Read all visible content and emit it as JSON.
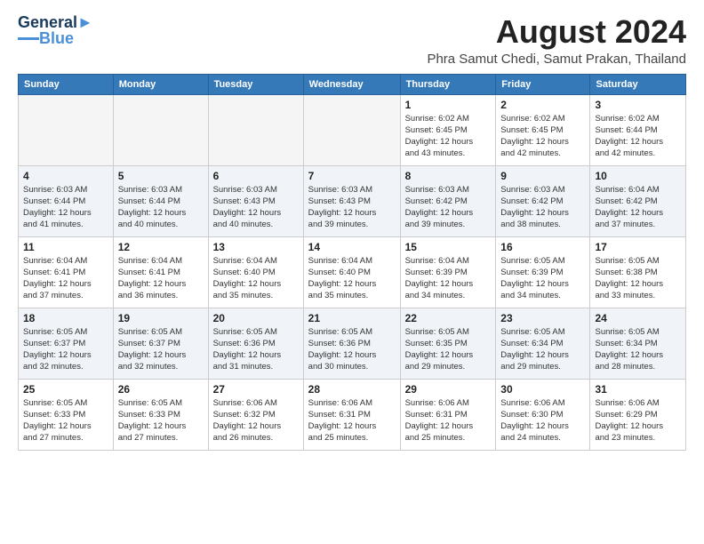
{
  "header": {
    "logo": {
      "line1": "General",
      "line2": "Blue"
    },
    "title": "August 2024",
    "location": "Phra Samut Chedi, Samut Prakan, Thailand"
  },
  "weekdays": [
    "Sunday",
    "Monday",
    "Tuesday",
    "Wednesday",
    "Thursday",
    "Friday",
    "Saturday"
  ],
  "weeks": [
    [
      {
        "date": "",
        "info": ""
      },
      {
        "date": "",
        "info": ""
      },
      {
        "date": "",
        "info": ""
      },
      {
        "date": "",
        "info": ""
      },
      {
        "date": "1",
        "info": "Sunrise: 6:02 AM\nSunset: 6:45 PM\nDaylight: 12 hours\nand 43 minutes."
      },
      {
        "date": "2",
        "info": "Sunrise: 6:02 AM\nSunset: 6:45 PM\nDaylight: 12 hours\nand 42 minutes."
      },
      {
        "date": "3",
        "info": "Sunrise: 6:02 AM\nSunset: 6:44 PM\nDaylight: 12 hours\nand 42 minutes."
      }
    ],
    [
      {
        "date": "4",
        "info": "Sunrise: 6:03 AM\nSunset: 6:44 PM\nDaylight: 12 hours\nand 41 minutes."
      },
      {
        "date": "5",
        "info": "Sunrise: 6:03 AM\nSunset: 6:44 PM\nDaylight: 12 hours\nand 40 minutes."
      },
      {
        "date": "6",
        "info": "Sunrise: 6:03 AM\nSunset: 6:43 PM\nDaylight: 12 hours\nand 40 minutes."
      },
      {
        "date": "7",
        "info": "Sunrise: 6:03 AM\nSunset: 6:43 PM\nDaylight: 12 hours\nand 39 minutes."
      },
      {
        "date": "8",
        "info": "Sunrise: 6:03 AM\nSunset: 6:42 PM\nDaylight: 12 hours\nand 39 minutes."
      },
      {
        "date": "9",
        "info": "Sunrise: 6:03 AM\nSunset: 6:42 PM\nDaylight: 12 hours\nand 38 minutes."
      },
      {
        "date": "10",
        "info": "Sunrise: 6:04 AM\nSunset: 6:42 PM\nDaylight: 12 hours\nand 37 minutes."
      }
    ],
    [
      {
        "date": "11",
        "info": "Sunrise: 6:04 AM\nSunset: 6:41 PM\nDaylight: 12 hours\nand 37 minutes."
      },
      {
        "date": "12",
        "info": "Sunrise: 6:04 AM\nSunset: 6:41 PM\nDaylight: 12 hours\nand 36 minutes."
      },
      {
        "date": "13",
        "info": "Sunrise: 6:04 AM\nSunset: 6:40 PM\nDaylight: 12 hours\nand 35 minutes."
      },
      {
        "date": "14",
        "info": "Sunrise: 6:04 AM\nSunset: 6:40 PM\nDaylight: 12 hours\nand 35 minutes."
      },
      {
        "date": "15",
        "info": "Sunrise: 6:04 AM\nSunset: 6:39 PM\nDaylight: 12 hours\nand 34 minutes."
      },
      {
        "date": "16",
        "info": "Sunrise: 6:05 AM\nSunset: 6:39 PM\nDaylight: 12 hours\nand 34 minutes."
      },
      {
        "date": "17",
        "info": "Sunrise: 6:05 AM\nSunset: 6:38 PM\nDaylight: 12 hours\nand 33 minutes."
      }
    ],
    [
      {
        "date": "18",
        "info": "Sunrise: 6:05 AM\nSunset: 6:37 PM\nDaylight: 12 hours\nand 32 minutes."
      },
      {
        "date": "19",
        "info": "Sunrise: 6:05 AM\nSunset: 6:37 PM\nDaylight: 12 hours\nand 32 minutes."
      },
      {
        "date": "20",
        "info": "Sunrise: 6:05 AM\nSunset: 6:36 PM\nDaylight: 12 hours\nand 31 minutes."
      },
      {
        "date": "21",
        "info": "Sunrise: 6:05 AM\nSunset: 6:36 PM\nDaylight: 12 hours\nand 30 minutes."
      },
      {
        "date": "22",
        "info": "Sunrise: 6:05 AM\nSunset: 6:35 PM\nDaylight: 12 hours\nand 29 minutes."
      },
      {
        "date": "23",
        "info": "Sunrise: 6:05 AM\nSunset: 6:34 PM\nDaylight: 12 hours\nand 29 minutes."
      },
      {
        "date": "24",
        "info": "Sunrise: 6:05 AM\nSunset: 6:34 PM\nDaylight: 12 hours\nand 28 minutes."
      }
    ],
    [
      {
        "date": "25",
        "info": "Sunrise: 6:05 AM\nSunset: 6:33 PM\nDaylight: 12 hours\nand 27 minutes."
      },
      {
        "date": "26",
        "info": "Sunrise: 6:05 AM\nSunset: 6:33 PM\nDaylight: 12 hours\nand 27 minutes."
      },
      {
        "date": "27",
        "info": "Sunrise: 6:06 AM\nSunset: 6:32 PM\nDaylight: 12 hours\nand 26 minutes."
      },
      {
        "date": "28",
        "info": "Sunrise: 6:06 AM\nSunset: 6:31 PM\nDaylight: 12 hours\nand 25 minutes."
      },
      {
        "date": "29",
        "info": "Sunrise: 6:06 AM\nSunset: 6:31 PM\nDaylight: 12 hours\nand 25 minutes."
      },
      {
        "date": "30",
        "info": "Sunrise: 6:06 AM\nSunset: 6:30 PM\nDaylight: 12 hours\nand 24 minutes."
      },
      {
        "date": "31",
        "info": "Sunrise: 6:06 AM\nSunset: 6:29 PM\nDaylight: 12 hours\nand 23 minutes."
      }
    ]
  ]
}
